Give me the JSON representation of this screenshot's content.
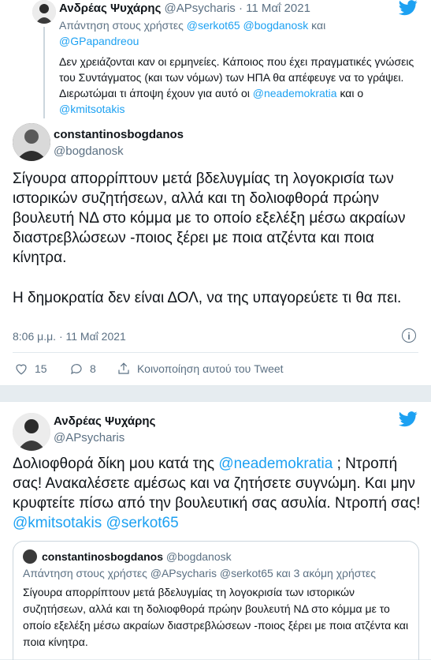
{
  "colors": {
    "accent": "#1da1f2",
    "muted": "#5b7083",
    "text": "#0f1419",
    "bg": "#e6ecf0"
  },
  "icons": [
    "twitter-bird-icon",
    "info-icon",
    "like-icon",
    "reply-icon",
    "share-icon"
  ],
  "tweet1": {
    "parent": {
      "name": "Ανδρέας Ψυχάρης",
      "handle": "@APsycharis",
      "date": "· 11 Μαΐ 2021",
      "reply_prefix": "Απάντηση στους χρήστες",
      "reply_users": "@serkot65 @bogdanosk",
      "reply_and": "και",
      "reply_last": "@GPapandreou",
      "text_main": "Δεν χρειάζονται καν οι ερμηνείες. Κάποιος που έχει πραγματικές γνώσεις του Συντάγματος (και των νόμων) των ΗΠΑ θα απέφευγε να το γράψει. Διερωτώμαι τι άποψη έχουν για αυτό οι",
      "mention1": "@neademokratia",
      "text_and": "και ο",
      "mention2": "@kmitsotakis"
    },
    "author": {
      "name": "constantinosbogdanos",
      "handle": "@bogdanosk"
    },
    "paragraph1": "Σίγουρα απορρίπτουν μετά βδελυγμίας τη λογοκρισία των ιστορικών συζητήσεων, αλλά και τη δολιοφθορά πρώην βουλευτή ΝΔ στο κόμμα με το οποίο εξελέξη μέσω ακραίων διαστρεβλώσεων -ποιος ξέρει με ποια ατζέντα και ποια κίνητρα.",
    "paragraph2": "Η δημοκρατία δεν είναι ΔΟΛ, να της υπαγορεύετε τι θα πει.",
    "timestamp": "8:06 μ.μ. · 11 Μαΐ 2021",
    "likes": "15",
    "replies": "8",
    "share_label": "Κοινοποίηση αυτού του Tweet"
  },
  "tweet2": {
    "author": {
      "name": "Ανδρέας Ψυχάρης",
      "handle": "@APsycharis"
    },
    "text_a": "Δολιοφθορά δίκη μου κατά της",
    "mention1": "@neademokratia",
    "text_b": "; Ντροπή σας! Ανακαλέσετε αμέσως και να ζητήσετε συγνώμη. Και μην κρυφτείτε πίσω από την βουλευτική σας ασυλία.  Ντροπή σας!",
    "mention2": "@kmitsotakis",
    "mention3": "@serkot65",
    "quoted": {
      "name": "constantinosbogdanos",
      "handle": "@bogdanosk",
      "reply_prefix": "Απάντηση στους χρήστες",
      "reply_users": "@APsycharis @serkot65",
      "reply_more": "και 3 ακόμη χρήστες",
      "text": "Σίγουρα απορρίπτουν μετά βδελυγμίας τη λογοκρισία των ιστορικών συζητήσεων, αλλά και τη δολιοφθορά πρώην βουλευτή ΝΔ στο κόμμα με το οποίο εξελέξη μέσω ακραίων διαστρεβλώσεων -ποιος ξέρει με ποια ατζέντα και ποια κίνητρα."
    }
  }
}
